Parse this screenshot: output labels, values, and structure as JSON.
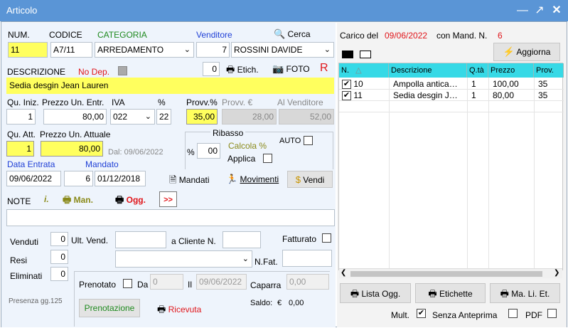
{
  "window": {
    "title": "Articolo"
  },
  "colors": {
    "titlebar": "#5a95d6",
    "highlight": "#ffff5e",
    "grid_header": "#36d9e6"
  },
  "header_labels": {
    "num": "NUM.",
    "codice": "CODICE",
    "categoria": "CATEGORIA",
    "venditore": "Venditore",
    "cerca": "Cerca"
  },
  "fields": {
    "num": "11",
    "codice": "A7/11",
    "categoria": "ARREDAMENTO",
    "venditore_num": "7",
    "venditore_nome": "ROSSINI DAVIDE",
    "descrizione_label": "DESCRIZIONE",
    "no_dep_label": "No Dep.",
    "etich_count": "0",
    "etich_label": "Etich.",
    "foto_label": "FOTO",
    "r_label": "R",
    "descrizione": "Sedia desgin Jean Lauren",
    "qu_iniz_label": "Qu. Iniz.",
    "prezzo_un_entr_label": "Prezzo Un. Entr.",
    "iva_label": "IVA",
    "perc_label": "%",
    "provv_perc_label": "Provv.%",
    "provv_eur_label": "Provv. €",
    "al_venditore_label": "Al Venditore",
    "qu_iniz": "1",
    "prezzo_un_entr": "80,00",
    "iva": "022",
    "perc": "22",
    "provv_perc": "35,00",
    "provv_eur": "28,00",
    "al_venditore": "52,00",
    "qu_att_label": "Qu. Att.",
    "prezzo_un_attuale_label": "Prezzo Un. Attuale",
    "ribasso_label": "Ribasso",
    "auto_label": "AUTO",
    "qu_att": "1",
    "prezzo_un_attuale": "80,00",
    "dal_label": "Dal: 09/06/2022",
    "ribasso_perc_label": "%",
    "ribasso_value": "00",
    "calcola_label": "Calcola %",
    "applica_label": "Applica",
    "data_entrata_label": "Data Entrata",
    "mandato_label": "Mandato",
    "data_entrata": "09/06/2022",
    "mandato_num": "6",
    "mandato_data": "01/12/2018",
    "mandati_label": "Mandati",
    "movimenti_label": "Movimenti",
    "vendi_label": "Vendi",
    "note_label": "NOTE",
    "note_i_label": "i.",
    "man_label": "Man.",
    "ogg_label": "Ogg.",
    "next_label": ">>",
    "note_text": "",
    "venduti_label": "Venduti",
    "venduti": "0",
    "ult_vend_label": "Ult. Vend.",
    "a_cliente_label": "a Cliente N.",
    "fatturato_label": "Fatturato",
    "resi_label": "Resi",
    "resi": "0",
    "n_fat_label": "N.Fat.",
    "eliminati_label": "Eliminati",
    "eliminati": "0",
    "prenotato_label": "Prenotato",
    "da_label": "Da",
    "da_value": "0",
    "il_label": "Il",
    "il_value": "09/06/2022",
    "caparra_label": "Caparra",
    "caparra": "0,00",
    "presenza_label": "Presenza gg.125",
    "prenotazione_label": "Prenotazione",
    "ricevuta_label": "Ricevuta",
    "saldo_label": "Saldo:",
    "saldo_euro": "€",
    "saldo_value": "0,00"
  },
  "right": {
    "carico_del_label": "Carico del",
    "carico_date": "09/06/2022",
    "con_mand_label": "con Mand. N.",
    "mand_num": "6",
    "aggiorna_label": "Aggiorna",
    "columns": [
      "N.",
      "Descrizione",
      "Q.tà",
      "Prezzo",
      "Prov."
    ],
    "rows": [
      {
        "checked": true,
        "n": "10",
        "descrizione": "Ampolla antica…",
        "qta": "1",
        "prezzo": "100,00",
        "prov": "35"
      },
      {
        "checked": true,
        "n": "11",
        "descrizione": "Sedia desgin J…",
        "qta": "1",
        "prezzo": "80,00",
        "prov": "35"
      }
    ],
    "lista_ogg_label": "Lista Ogg.",
    "etichette_label": "Etichette",
    "ma_li_et_label": "Ma. Li. Et.",
    "mult_label": "Mult.",
    "senza_anteprima_label": "Senza Anteprima",
    "pdf_label": "PDF"
  }
}
